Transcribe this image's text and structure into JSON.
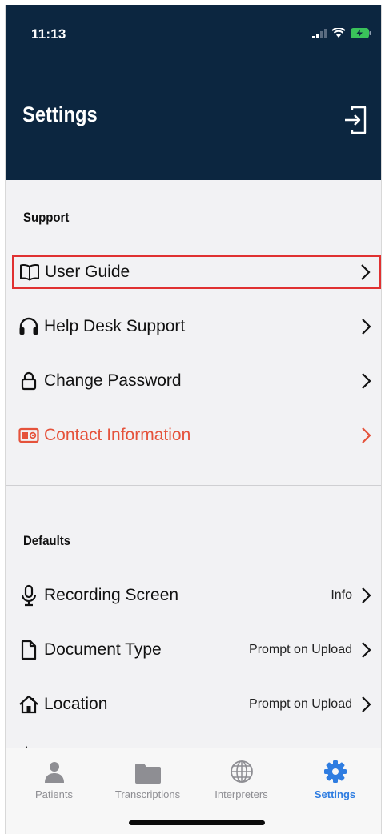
{
  "status_bar": {
    "time": "11:13"
  },
  "header": {
    "title": "Settings",
    "logout_icon": "sign-out-icon"
  },
  "support": {
    "title": "Support",
    "items": [
      {
        "label": "User Guide",
        "icon": "book-icon",
        "highlighted": true
      },
      {
        "label": "Help Desk Support",
        "icon": "headphones-icon"
      },
      {
        "label": "Change Password",
        "icon": "lock-icon"
      },
      {
        "label": "Contact Information",
        "icon": "contact-card-icon",
        "color": "#e5523b"
      }
    ]
  },
  "defaults": {
    "title": "Defaults",
    "items": [
      {
        "label": "Recording Screen",
        "value": "Info",
        "icon": "microphone-icon"
      },
      {
        "label": "Document Type",
        "value": "Prompt on Upload",
        "icon": "document-icon"
      },
      {
        "label": "Location",
        "value": "Prompt on Upload",
        "icon": "home-icon"
      }
    ]
  },
  "tabbar": {
    "tabs": [
      {
        "label": "Patients",
        "icon": "person-icon"
      },
      {
        "label": "Transcriptions",
        "icon": "folder-icon"
      },
      {
        "label": "Interpreters",
        "icon": "globe-icon"
      },
      {
        "label": "Settings",
        "icon": "gear-icon",
        "active": true
      }
    ]
  },
  "colors": {
    "header_bg": "#0c2640",
    "accent": "#2f7de1",
    "contact_red": "#e5523b",
    "highlight_border": "#e03131"
  }
}
